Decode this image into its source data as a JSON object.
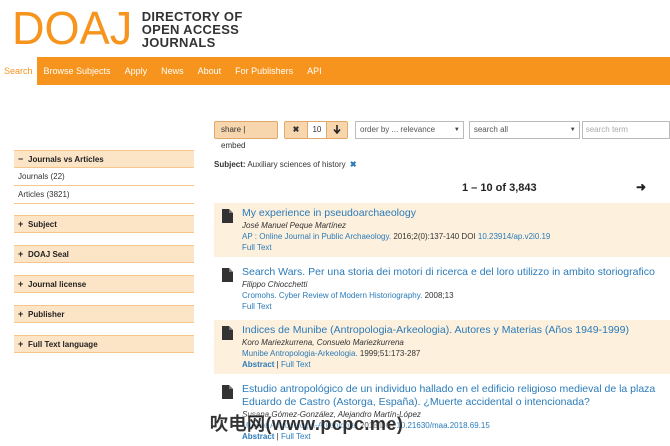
{
  "logo": {
    "big": "DOAJ",
    "line1": "DIRECTORY OF",
    "line2": "OPEN ACCESS",
    "line3": "JOURNALS"
  },
  "nav": [
    {
      "label": "Search",
      "active": true
    },
    {
      "label": "Browse Subjects"
    },
    {
      "label": "Apply"
    },
    {
      "label": "News"
    },
    {
      "label": "About"
    },
    {
      "label": "For Publishers"
    },
    {
      "label": "API"
    }
  ],
  "toolbar": {
    "share": "share | embed",
    "remove": "✖",
    "page_size": "10",
    "down": "🡓",
    "order": "order by ... relevance",
    "field": "search all",
    "search_placeholder": "search term"
  },
  "facets": [
    {
      "label": "Journals vs Articles",
      "expanded": true,
      "rows": [
        "Journals (22)",
        "Articles (3821)"
      ]
    },
    {
      "label": "Subject"
    },
    {
      "label": "DOAJ Seal"
    },
    {
      "label": "Journal license"
    },
    {
      "label": "Publisher"
    },
    {
      "label": "Full Text language"
    }
  ],
  "subject_filter": {
    "label": "Subject:",
    "value": "Auxiliary sciences of history",
    "remove": "✖"
  },
  "results_count": "1 – 10 of 3,843",
  "next_arrow": "➜",
  "results": [
    {
      "title": "My experience in pseudoarchaeology",
      "authors": "José Manuel Peque Martínez",
      "journal": "AP : Online Journal in Public Archaeology.",
      "citation": "2016;2(0):137-140 DOI",
      "doi": "10.23914/ap.v2i0.19",
      "abstract": "",
      "fulltext": "Full Text"
    },
    {
      "title": "Search Wars. Per una storia dei motori di ricerca e del loro utilizzo in ambito storiografico",
      "authors": "Filippo Chiocchetti",
      "journal": "Cromohs. Cyber Review of Modern Historiography.",
      "citation": "2008;13",
      "doi": "",
      "abstract": "",
      "fulltext": "Full Text"
    },
    {
      "title": "Indices de Munibe (Antropologia-Arkeologia). Autores y Materias (Años 1949-1999)",
      "authors": "Koro Mariezkurrena, Consuelo Mariezkurrena",
      "journal": "Munibe Antropologia-Arkeologia.",
      "citation": "1999;51:173-287",
      "doi": "",
      "abstract": "Abstract",
      "fulltext": "Full Text"
    },
    {
      "title": "Estudio antropológico de un individuo hallado en el edificio religioso medieval de la plaza Eduardo de Castro (Astorga, España). ¿Muerte accidental o intencionada?",
      "authors": "Susana Gómez-González, Alejandro Martín-López",
      "journal": "Munibe Antropologia-Arkeologia.",
      "citation": "2018 DOI",
      "doi": "10.21630/maa.2018.69.15",
      "abstract": "Abstract",
      "fulltext": "Full Text"
    }
  ],
  "watermark": "吹电网(www.pcpc.me)"
}
